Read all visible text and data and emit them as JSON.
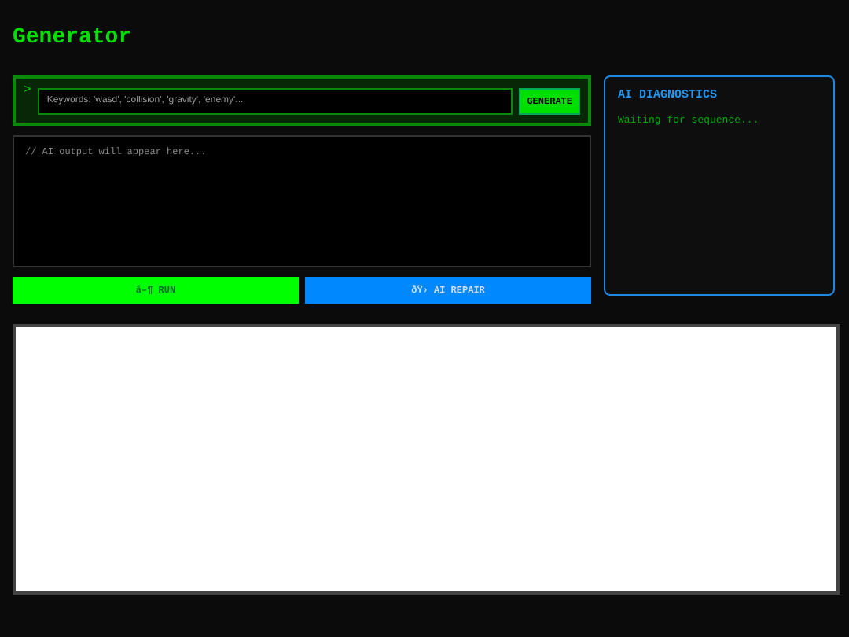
{
  "title": "Generator",
  "prompt": {
    "prefix": ">",
    "placeholder": "Keywords: 'wasd', 'collision', 'gravity', 'enemy'...",
    "button": "GENERATE"
  },
  "output": {
    "placeholder": "// AI output will appear here..."
  },
  "actions": [
    {
      "kind": "run",
      "label": "â–¶ RUN"
    },
    {
      "kind": "repair",
      "label": "ðŸ›  AI REPAIR"
    }
  ],
  "diagnostics": {
    "title": "AI DIAGNOSTICS",
    "message": "Waiting for sequence..."
  }
}
